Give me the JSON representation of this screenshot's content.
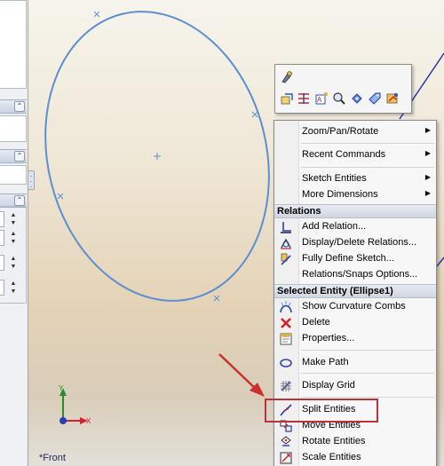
{
  "view_label": "*Front",
  "colors": {
    "sketch": "#5b8fd2",
    "arrow": "#c9302c",
    "axis_x": "#c8242d",
    "axis_y": "#2d8a2d",
    "highlight": "#b8343a"
  },
  "mini_toolbar": {
    "icons": [
      "rebuild-icon",
      "sketch-icon",
      "mirror-icon",
      "smart-dimension-icon",
      "zoom-icon",
      "normal-to-icon",
      "tag-icon",
      "display-style-icon"
    ]
  },
  "menu": {
    "view_group": [
      {
        "label": "Zoom/Pan/Rotate",
        "submenu": true
      },
      {
        "label": "Recent Commands",
        "submenu": true
      }
    ],
    "sketch_group": [
      {
        "label": "Sketch Entities",
        "submenu": true
      },
      {
        "label": "More Dimensions",
        "submenu": true
      }
    ],
    "relations_header": "Relations",
    "relations": [
      {
        "label": "Add Relation...",
        "icon": "add-relation-icon"
      },
      {
        "label": "Display/Delete Relations...",
        "icon": "display-relations-icon"
      },
      {
        "label": "Fully Define Sketch...",
        "icon": "fully-define-icon"
      },
      {
        "label": "Relations/Snaps Options...",
        "icon": ""
      }
    ],
    "selected_header": "Selected Entity (Ellipse1)",
    "selected": [
      {
        "label": "Show Curvature Combs",
        "icon": "curvature-icon"
      },
      {
        "label": "Delete",
        "icon": "delete-icon"
      },
      {
        "label": "Properties...",
        "icon": "properties-icon"
      },
      {
        "label": "Make Path",
        "icon": "make-path-icon"
      },
      {
        "label": "Display Grid",
        "icon": "grid-icon"
      },
      {
        "label": "Split Entities",
        "icon": "split-icon"
      },
      {
        "label": "Move Entities",
        "icon": "move-icon"
      },
      {
        "label": "Rotate Entities",
        "icon": "rotate-icon"
      },
      {
        "label": "Scale Entities",
        "icon": "scale-icon"
      }
    ]
  }
}
